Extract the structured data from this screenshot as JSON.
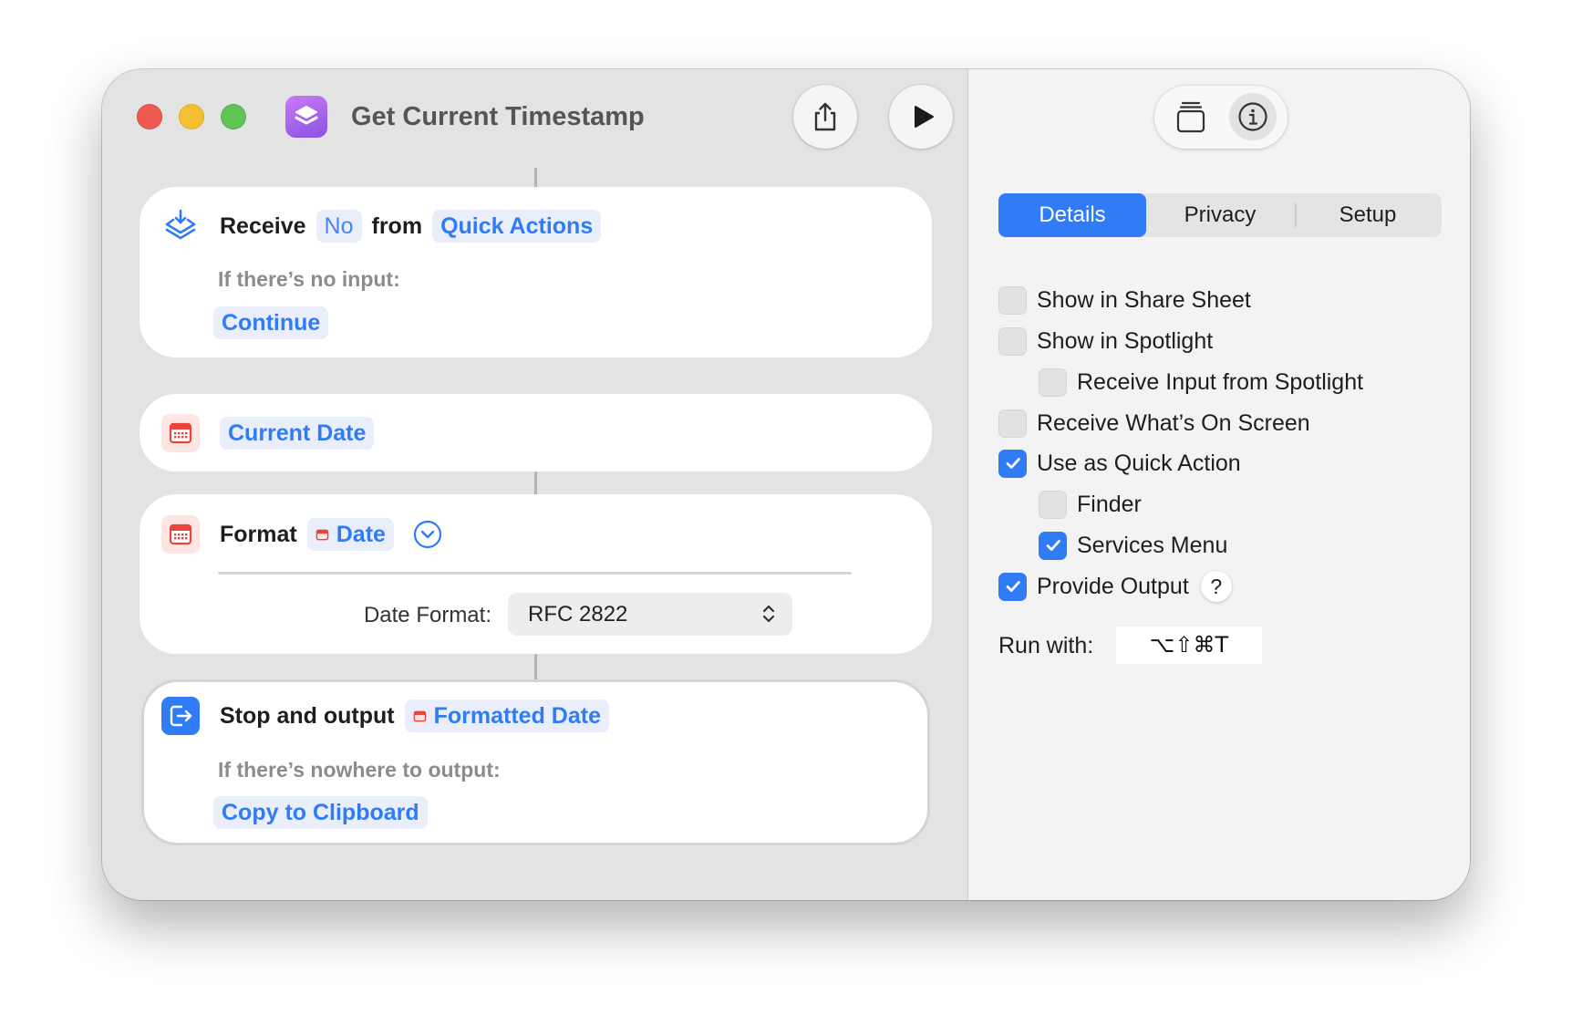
{
  "window": {
    "title": "Get Current Timestamp"
  },
  "icons": {
    "app": "shortcuts-app-icon",
    "share": "share-icon",
    "run": "play-icon",
    "library": "stack-icon",
    "info": "info-icon"
  },
  "actions": {
    "receive": {
      "label": "Receive",
      "input": "No",
      "from": "from",
      "source": "Quick Actions",
      "no_input_label": "If there’s no input:",
      "no_input_action": "Continue"
    },
    "current_date": {
      "label": "Current Date"
    },
    "format": {
      "label": "Format",
      "input": "Date",
      "param_label": "Date Format:",
      "param_value": "RFC 2822"
    },
    "stop": {
      "label": "Stop and output",
      "input": "Formatted Date",
      "no_output_label": "If there’s nowhere to output:",
      "no_output_action": "Copy to Clipboard"
    }
  },
  "inspector": {
    "tabs": [
      "Details",
      "Privacy",
      "Setup"
    ],
    "selected_tab": "Details",
    "options": [
      {
        "label": "Show in Share Sheet",
        "checked": false
      },
      {
        "label": "Show in Spotlight",
        "checked": false
      },
      {
        "label": "Receive Input from Spotlight",
        "checked": false
      },
      {
        "label": "Receive What’s On Screen",
        "checked": false
      },
      {
        "label": "Use as Quick Action",
        "checked": true
      },
      {
        "label": "Finder",
        "checked": false
      },
      {
        "label": "Services Menu",
        "checked": true
      },
      {
        "label": "Provide Output",
        "checked": true
      }
    ],
    "help_label": "?",
    "run_with_label": "Run with:",
    "shortcut": "⌥⇧⌘T"
  },
  "colors": {
    "accent": "#2f7cf6",
    "calendar": "#e8453c",
    "close": "#ee5a52",
    "minimize": "#f5bf32",
    "zoom": "#5fc454"
  }
}
